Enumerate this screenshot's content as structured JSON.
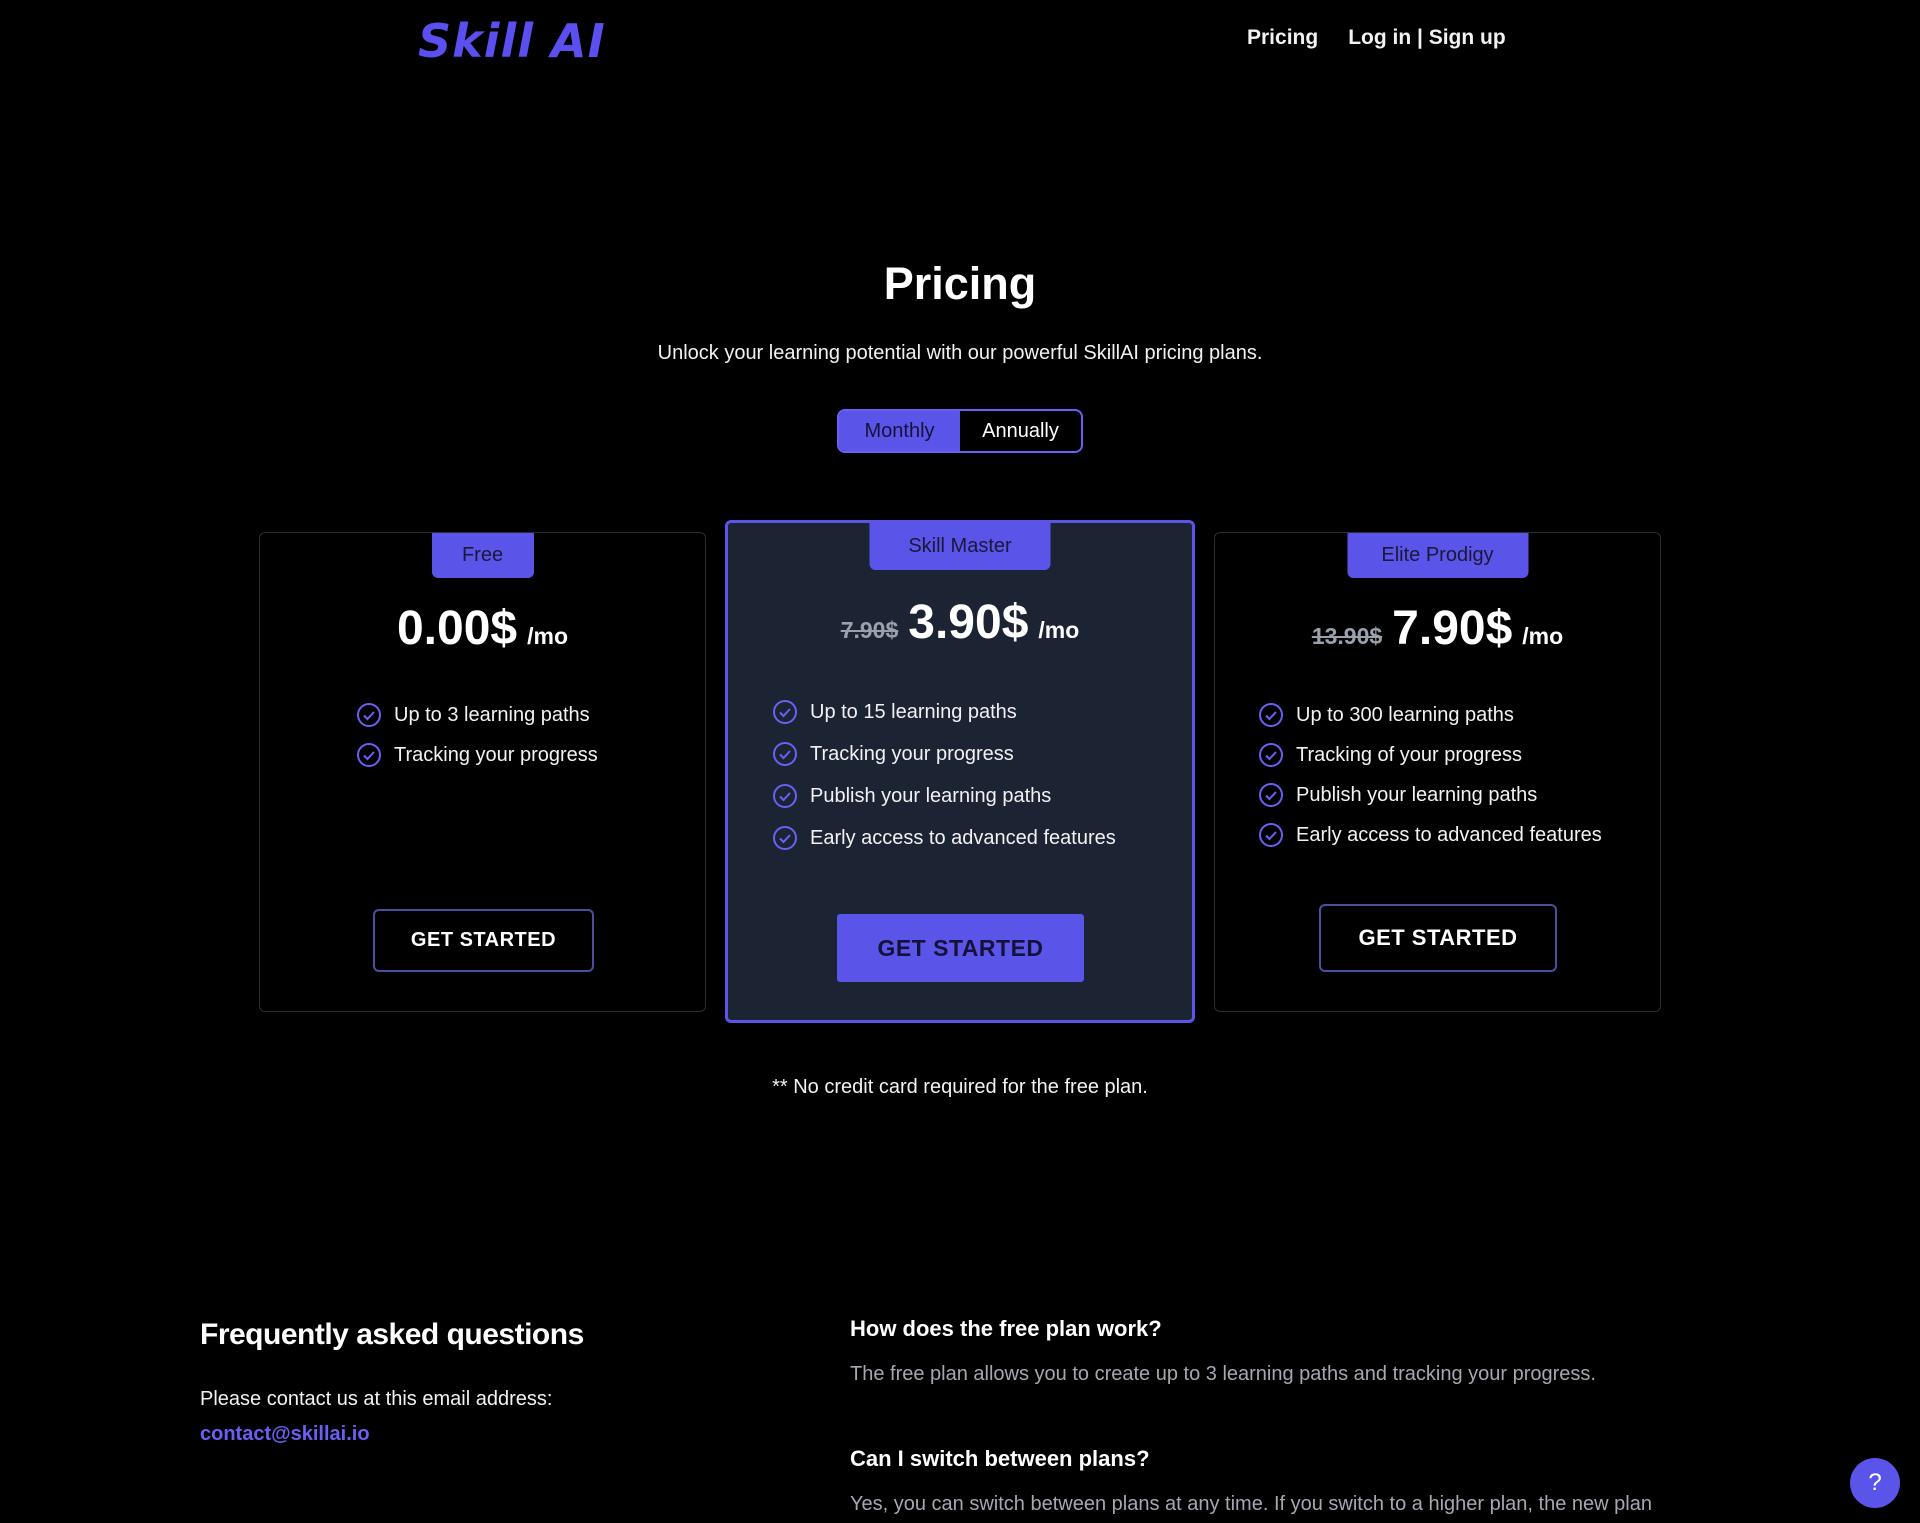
{
  "header": {
    "logo": "Skill AI",
    "nav": {
      "pricing": "Pricing",
      "auth": "Log in | Sign up"
    }
  },
  "hero": {
    "title": "Pricing",
    "subtitle": "Unlock your learning potential with our powerful SkillAI pricing plans."
  },
  "billing_toggle": {
    "monthly": "Monthly",
    "annually": "Annually",
    "selected": "Monthly"
  },
  "plans": [
    {
      "name": "Free",
      "old_price": "",
      "price": "0.00$",
      "period": "/mo",
      "features": [
        "Up to 3 learning paths",
        "Tracking your progress"
      ],
      "cta": "GET STARTED"
    },
    {
      "name": "Skill Master",
      "old_price": "7.90$",
      "price": "3.90$",
      "period": "/mo",
      "features": [
        "Up to 15 learning paths",
        "Tracking your progress",
        "Publish your learning paths",
        "Early access to advanced features"
      ],
      "cta": "GET STARTED"
    },
    {
      "name": "Elite Prodigy",
      "old_price": "13.90$",
      "price": "7.90$",
      "period": "/mo",
      "features": [
        "Up to 300 learning paths",
        "Tracking of your progress",
        "Publish your learning paths",
        "Early access to advanced features"
      ],
      "cta": "GET STARTED"
    }
  ],
  "footnote": "** No credit card required for the free plan.",
  "faq": {
    "title": "Frequently asked questions",
    "contact_text": "Please contact us at this email address:",
    "email": "contact@skillai.io",
    "items": [
      {
        "question": "How does the free plan work?",
        "answer": "The free plan allows you to create up to 3 learning paths and tracking your progress."
      },
      {
        "question": "Can I switch between plans?",
        "answer": "Yes, you can switch between plans at any time. If you switch to a higher plan, the new plan"
      }
    ]
  },
  "help_button": {
    "label": "?"
  },
  "colors": {
    "accent": "#5b54e8",
    "background": "#000000",
    "featured_card": "#1c2333"
  },
  "icons": {
    "feature_check": "check-circle-icon"
  }
}
